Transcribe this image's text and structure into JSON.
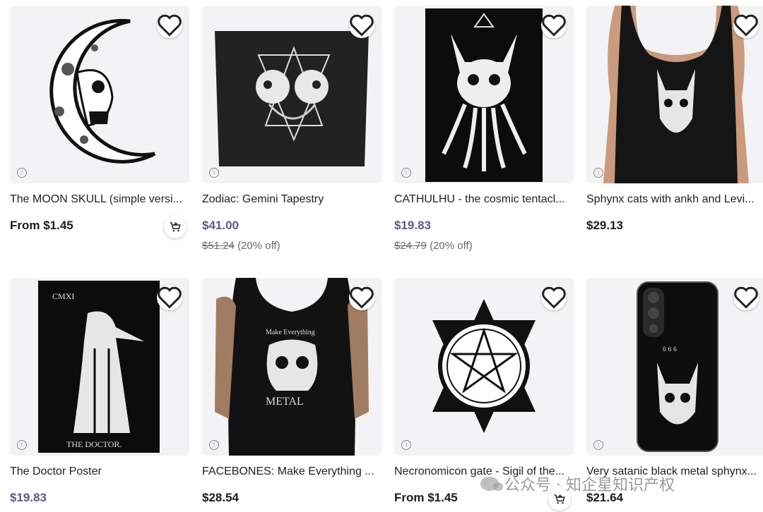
{
  "products": [
    {
      "title": "The MOON SKULL (simple versi...",
      "price": "From $1.45",
      "original_price": "",
      "discount": "",
      "on_sale": false,
      "has_cart": true
    },
    {
      "title": "Zodiac: Gemini Tapestry",
      "price": "$41.00",
      "original_price": "$51.24",
      "discount": "(20% off)",
      "on_sale": true,
      "has_cart": false
    },
    {
      "title": "CATHULHU - the cosmic tentacl...",
      "price": "$19.83",
      "original_price": "$24.79",
      "discount": "(20% off)",
      "on_sale": true,
      "has_cart": false
    },
    {
      "title": "Sphynx cats with ankh and Levi...",
      "price": "$29.13",
      "original_price": "",
      "discount": "",
      "on_sale": false,
      "has_cart": false
    },
    {
      "title": "The Doctor Poster",
      "price": "$19.83",
      "original_price": "",
      "discount": "",
      "on_sale": true,
      "has_cart": false
    },
    {
      "title": "FACEBONES: Make Everything ...",
      "price": "$28.54",
      "original_price": "",
      "discount": "",
      "on_sale": false,
      "has_cart": false
    },
    {
      "title": "Necronomicon gate - Sigil of the...",
      "price": "From $1.45",
      "original_price": "",
      "discount": "",
      "on_sale": false,
      "has_cart": true
    },
    {
      "title": "Very satanic black metal sphynx...",
      "price": "$21.64",
      "original_price": "",
      "discount": "",
      "on_sale": false,
      "has_cart": false
    }
  ],
  "artwork_text": {
    "doctor_top": "CMXI",
    "doctor_bottom": "THE DOCTOR.",
    "tank_top": "Make Everything",
    "tank_bottom": "METAL",
    "phone_digits": "6 6 6"
  },
  "icons": {
    "favorite": "heart-icon",
    "info": "info-icon",
    "cart": "add-to-cart-icon"
  },
  "watermark": {
    "text": "公众号 · 知企星知识产权"
  },
  "colors": {
    "sale_price": "#5a5a86",
    "thumb_bg": "#f2f2f4",
    "text": "#1c1c1c"
  }
}
